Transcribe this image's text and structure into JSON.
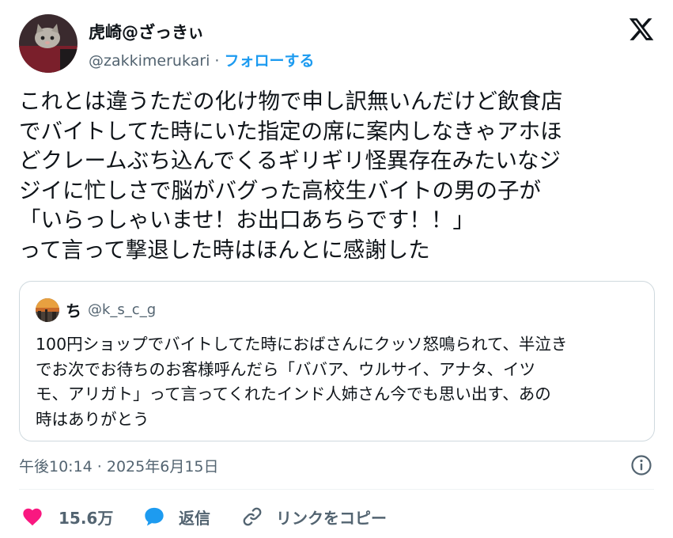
{
  "tweet": {
    "display_name": "虎崎@ざっきぃ",
    "handle": "@zakkimerukari",
    "separator": " · ",
    "follow_label": "フォローする",
    "text_lines": [
      "これとは違うただの化け物で申し訳無いんだけど飲食店",
      "でバイトしてた時にいた指定の席に案内しなきゃアホほ",
      "どクレームぶち込んでくるギリギリ怪異存在みたいなジ",
      "ジイに忙しさで脳がバグった高校生バイトの男の子が",
      "「いらっしゃいませ！お出口あちらです！！」",
      "って言って撃退した時はほんとに感謝した"
    ],
    "timestamp": "午後10:14 · 2025年6月15日"
  },
  "quote": {
    "display_name": "ち",
    "handle": "@k_s_c_g",
    "text_lines": [
      "100円ショップでバイトしてた時におばさんにクッソ怒鳴られて、半泣き",
      "でお次でお待ちのお客様呼んだら「ババア、ウルサイ、アナタ、イツ",
      "モ、アリガト」って言ってくれたインド人姉さん今でも思い出す、あの",
      "時はありがとう"
    ]
  },
  "actions": {
    "like_count": "15.6万",
    "reply_label": "返信",
    "copy_link_label": "リンクをコピー"
  },
  "colors": {
    "accent": "#1d9bf0",
    "like": "#f91880",
    "text": "#0f1419",
    "muted": "#536471",
    "border": "#cfd9de"
  },
  "icons": {
    "brand": "x-logo",
    "info": "info-icon",
    "like": "heart-icon",
    "reply": "speech-bubble-icon",
    "copy": "link-icon"
  }
}
